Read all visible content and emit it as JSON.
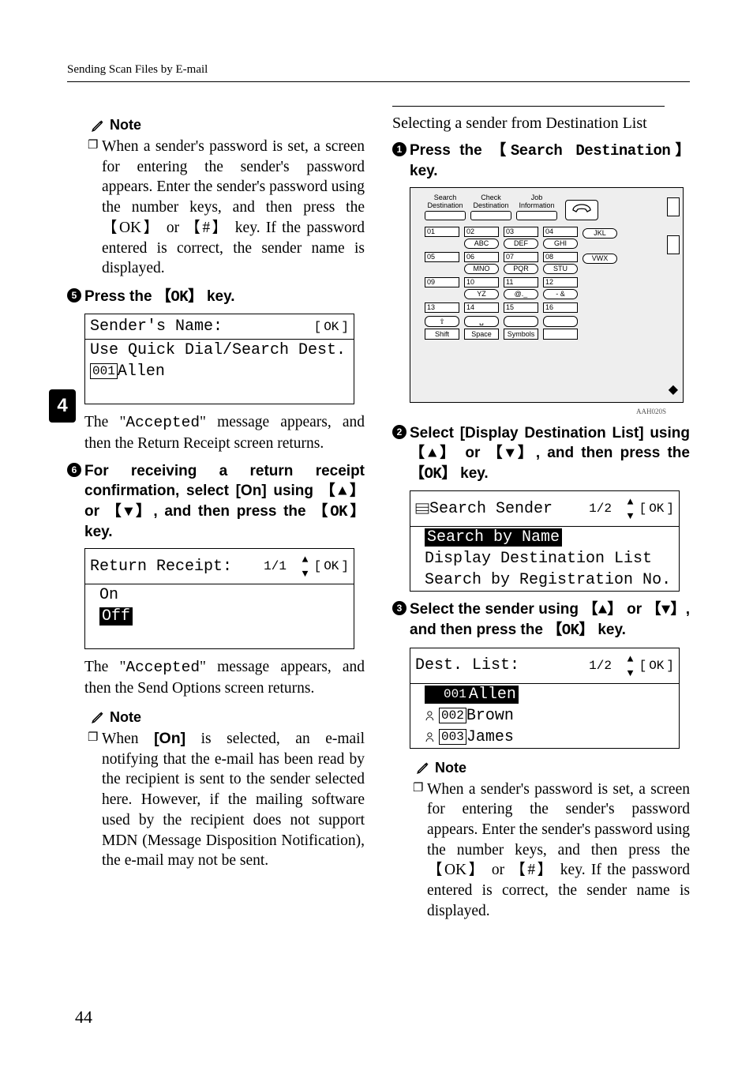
{
  "running_head": "Sending Scan Files by E-mail",
  "section_tab": "4",
  "page_number": "44",
  "note_label": "Note",
  "col1": {
    "note1": "When a sender's password is set, a screen for entering the sender's password appears. Enter the sender's password using the number keys, and then press the ",
    "note1_key1": "OK",
    "note1_mid": " or ",
    "note1_key2": "#",
    "note1_tail": " key. If the password entered is correct, the sender name is displayed.",
    "step5_num": "5",
    "step5_text_a": "Press the ",
    "step5_key": "OK",
    "step5_text_b": " key.",
    "screen1": {
      "title": "Sender's Name:",
      "ok": "OK",
      "line2": "Use Quick Dial/Search Dest.",
      "line3_num": "001",
      "line3_name": "Allen"
    },
    "para1_a": "The \"",
    "para1_code": "Accepted",
    "para1_b": "\" message appears, and then the Return Receipt screen returns.",
    "step6_num": "6",
    "step6_text_a": "For receiving a return receipt confirmation, select ",
    "step6_on": "[On]",
    "step6_text_b": " using ",
    "step6_up": "▲",
    "step6_text_c": " or ",
    "step6_dn": "▼",
    "step6_text_d": ", and then press the ",
    "step6_ok": "OK",
    "step6_text_e": " key.",
    "screen2": {
      "title": "Return Receipt:",
      "page": "1/1",
      "ok": "OK",
      "on": "On",
      "off": "Off"
    },
    "para2_a": "The \"",
    "para2_code": "Accepted",
    "para2_b": "\" message appears, and then the Send Options screen returns.",
    "note2_a": "When ",
    "note2_on": "[On]",
    "note2_b": " is selected, an e-mail notifying that the e-mail has been read by the recipient is sent to the sender selected here. However, if the mailing software used by the recipient does not support MDN (Message Disposition Notification), the e-mail may not be sent."
  },
  "col2": {
    "subhead": "Selecting a sender from Destination List",
    "stepA_num": "1",
    "stepA_text_a": "Press the ",
    "stepA_key": "Search Destination",
    "stepA_text_b": " key.",
    "panel": {
      "tabs": [
        "Search\nDestination",
        "Check\nDestination",
        "Job\nInformation"
      ],
      "rows": [
        [
          {
            "n": "01",
            "l": ""
          },
          {
            "n": "02",
            "l": "ABC"
          },
          {
            "n": "03",
            "l": "DEF"
          },
          {
            "n": "04",
            "l": "GHI"
          },
          {
            "n": "",
            "l": "JKL"
          }
        ],
        [
          {
            "n": "05",
            "l": ""
          },
          {
            "n": "06",
            "l": "MNO"
          },
          {
            "n": "07",
            "l": "PQR"
          },
          {
            "n": "08",
            "l": "STU"
          },
          {
            "n": "",
            "l": "VWX"
          }
        ],
        [
          {
            "n": "09",
            "l": ""
          },
          {
            "n": "10",
            "l": "YZ"
          },
          {
            "n": "11",
            "l": "@._"
          },
          {
            "n": "12",
            "l": "- &"
          },
          {
            "n": "",
            "l": ""
          }
        ],
        [
          {
            "n": "13",
            "l": ""
          },
          {
            "n": "14",
            "l": ""
          },
          {
            "n": "15",
            "l": ""
          },
          {
            "n": "16",
            "l": ""
          }
        ]
      ],
      "bottom": [
        "Shift",
        "Space",
        "Symbols",
        ""
      ],
      "caption": "AAH020S"
    },
    "stepB_num": "2",
    "stepB_text_a": "Select ",
    "stepB_label": "[Display Destination List]",
    "stepB_text_b": " using ",
    "stepB_up": "▲",
    "stepB_text_c": " or ",
    "stepB_dn": "▼",
    "stepB_text_d": ", and then press the ",
    "stepB_ok": "OK",
    "stepB_text_e": " key.",
    "screen3": {
      "title": "Search Sender",
      "page": "1/2",
      "ok": "OK",
      "row1": "Search by Name",
      "row2": "Display Destination List",
      "row3": "Search by Registration No."
    },
    "stepC_num": "3",
    "stepC_text_a": "Select the sender using ",
    "stepC_up": "▲",
    "stepC_text_b": " or ",
    "stepC_dn": "▼",
    "stepC_text_c": ", and then press the ",
    "stepC_ok": "OK",
    "stepC_text_d": " key.",
    "screen4": {
      "title": "Dest. List:",
      "page": "1/2",
      "ok": "OK",
      "items": [
        {
          "num": "001",
          "name": "Allen",
          "sel": true
        },
        {
          "num": "002",
          "name": "Brown",
          "sel": false
        },
        {
          "num": "003",
          "name": "James",
          "sel": false
        }
      ]
    },
    "note3_a": "When a sender's password is set, a screen for entering the sender's password appears. Enter the sender's password using the number keys, and then press the ",
    "note3_k1": "OK",
    "note3_mid": " or ",
    "note3_k2": "#",
    "note3_b": " key. If the password entered is correct, the sender name is displayed."
  }
}
